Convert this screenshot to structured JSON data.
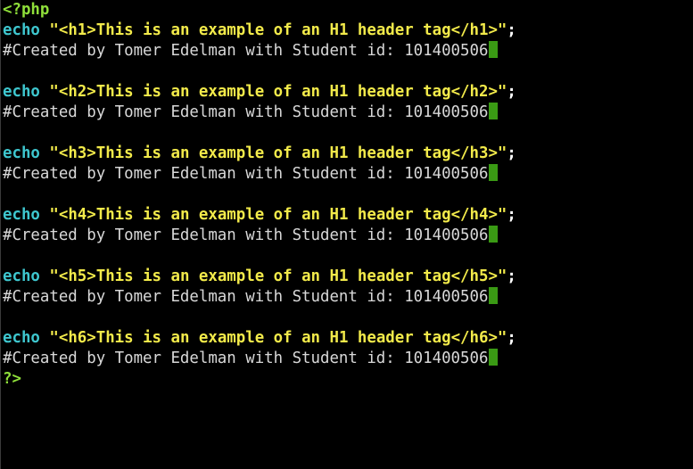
{
  "open_tag": "<?php",
  "close_tag": "?>",
  "blocks": [
    {
      "echo": "echo",
      "string": "\"<h1>This is an example of an H1 header tag</h1>\"",
      "semicolon": ";",
      "comment": "#Created by Tomer Edelman with Student id: 101400506"
    },
    {
      "echo": "echo",
      "string": "\"<h2>This is an example of an H1 header tag</h2>\"",
      "semicolon": ";",
      "comment": "#Created by Tomer Edelman with Student id: 101400506"
    },
    {
      "echo": "echo",
      "string": "\"<h3>This is an example of an H1 header tag</h3>\"",
      "semicolon": ";",
      "comment": "#Created by Tomer Edelman with Student id: 101400506"
    },
    {
      "echo": "echo",
      "string": "\"<h4>This is an example of an H1 header tag</h4>\"",
      "semicolon": ";",
      "comment": "#Created by Tomer Edelman with Student id: 101400506"
    },
    {
      "echo": "echo",
      "string": "\"<h5>This is an example of an H1 header tag</h5>\"",
      "semicolon": ";",
      "comment": "#Created by Tomer Edelman with Student id: 101400506"
    },
    {
      "echo": "echo",
      "string": "\"<h6>This is an example of an H1 header tag</h6>\"",
      "semicolon": ";",
      "comment": "#Created by Tomer Edelman with Student id: 101400506"
    }
  ],
  "colors": {
    "keyword": "#3ec7cf",
    "php_tag": "#8fdf3a",
    "string": "#f2ea4a",
    "comment": "#d8d8d8",
    "cursor": "#3a9a14",
    "background": "#000000"
  }
}
